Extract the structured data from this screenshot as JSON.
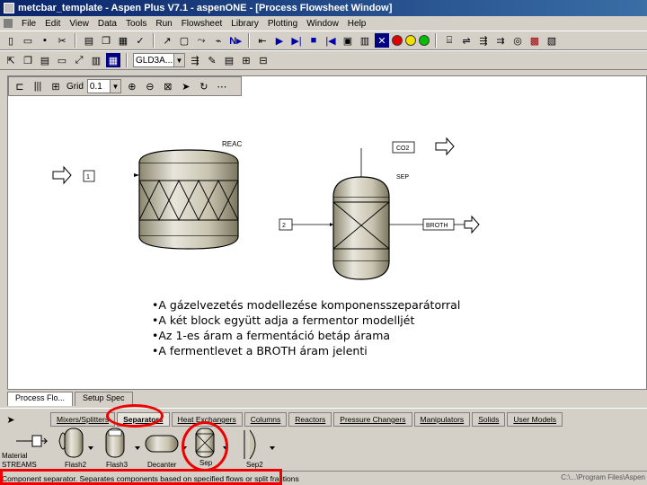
{
  "window": {
    "title": "metcbar_template - Aspen Plus V7.1 - aspenONE - [Process Flowsheet Window]"
  },
  "menu": {
    "items": [
      "File",
      "Edit",
      "View",
      "Data",
      "Tools",
      "Run",
      "Flowsheet",
      "Library",
      "Plotting",
      "Window",
      "Help"
    ]
  },
  "toolbar2": {
    "combo_value": "GLD3A..."
  },
  "flowsheet_toolbar": {
    "grid_label": "Grid",
    "grid_value": "0.1"
  },
  "flowsheet": {
    "block_reac_label": "REAC",
    "block_sep_label": "SEP",
    "stream_1_label": "1",
    "stream_2_label": "2",
    "stream_co2_label": "CO2",
    "stream_broth_label": "BROTH"
  },
  "notes": [
    "•A gázelvezetés modellezése komponensszeparátorral",
    "•A két block együtt adja a fermentor modelljét",
    "•Az 1-es áram a fermentáció betáp árama",
    "•A fermentlevet a BROTH áram jelenti"
  ],
  "nav_tabs": [
    "Process Flo...",
    "Setup Spec"
  ],
  "palette": {
    "tabs": [
      "Mixers/Splitters",
      "Separators",
      "Heat Exchangers",
      "Columns",
      "Reactors",
      "Pressure Changers",
      "Manipulators",
      "Solids",
      "User Models"
    ],
    "active_tab": "Separators",
    "items": [
      "Material STREAMS",
      "Flash2",
      "Flash3",
      "Decanter",
      "Sep",
      "Sep2"
    ]
  },
  "status": {
    "text": "Component separator. Separates components based on specified flows or split fractions",
    "right_text": "C:\\...\\Program Files\\Aspen"
  },
  "colors": {
    "title_gradient_start": "#0a246a",
    "highlight_red": "#ee0000",
    "vessel_fill": "#c8c4b0"
  }
}
